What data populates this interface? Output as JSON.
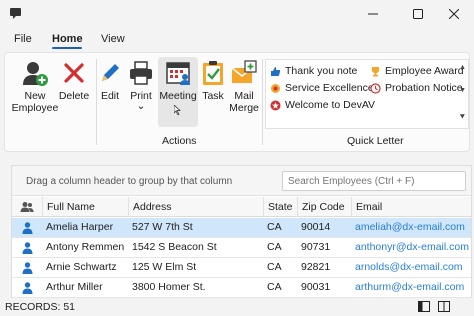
{
  "window": {
    "title": "",
    "controls": [
      "minimize",
      "maximize",
      "close"
    ]
  },
  "tabs": [
    {
      "label": "File",
      "active": false
    },
    {
      "label": "Home",
      "active": true
    },
    {
      "label": "View",
      "active": false
    }
  ],
  "ribbon": {
    "buttons": [
      {
        "label_line1": "New",
        "label_line2": "Employee",
        "icon": "add-user-icon"
      },
      {
        "label_line1": "Delete",
        "label_line2": "",
        "icon": "delete-x-icon"
      },
      {
        "label_line1": "Edit",
        "label_line2": "",
        "icon": "pencil-icon"
      },
      {
        "label_line1": "Print",
        "label_line2": "⌄",
        "icon": "printer-icon"
      },
      {
        "label_line1": "Meeting",
        "label_line2": "",
        "icon": "calendar-icon"
      },
      {
        "label_line1": "Task",
        "label_line2": "",
        "icon": "clipboard-check-icon"
      },
      {
        "label_line1": "Mail",
        "label_line2": "Merge",
        "icon": "mail-merge-icon"
      }
    ],
    "groups": {
      "actions": "Actions",
      "quick_letter": "Quick Letter"
    },
    "gallery_items": [
      {
        "label": "Thank you note",
        "icon": "thumbs-up-icon"
      },
      {
        "label": "Employee Award",
        "icon": "trophy-icon"
      },
      {
        "label": "Service Excellence",
        "icon": "medal-icon"
      },
      {
        "label": "Probation Notice",
        "icon": "clock-icon"
      },
      {
        "label": "Welcome to DevAV",
        "icon": "star-icon"
      }
    ]
  },
  "grid": {
    "group_hint": "Drag a column header to group by that column",
    "search_placeholder": "Search Employees (Ctrl + F)",
    "columns": [
      "Full Name",
      "Address",
      "State",
      "Zip Code",
      "Email"
    ],
    "rows": [
      {
        "name": "Amelia Harper",
        "address": "527 W 7th St",
        "state": "CA",
        "zip": "90014",
        "email": "ameliah@dx-email.com",
        "selected": true
      },
      {
        "name": "Antony Remmen",
        "address": "1542 S Beacon St",
        "state": "CA",
        "zip": "90731",
        "email": "anthonyr@dx-email.com",
        "selected": false
      },
      {
        "name": "Arnie Schwartz",
        "address": "125 W Elm St",
        "state": "CA",
        "zip": "92821",
        "email": "arnolds@dx-email.com",
        "selected": false
      },
      {
        "name": "Arthur Miller",
        "address": "3800 Homer St.",
        "state": "CA",
        "zip": "90031",
        "email": "arthurm@dx-email.com",
        "selected": false
      }
    ]
  },
  "status": {
    "records": "RECORDS: 51"
  },
  "colors": {
    "accent": "#1b5fb8",
    "selected_row": "#cfe6fb",
    "email_link": "#2a7ed0",
    "delete_red": "#d32f2f",
    "person_blue": "#1f6fc5"
  }
}
